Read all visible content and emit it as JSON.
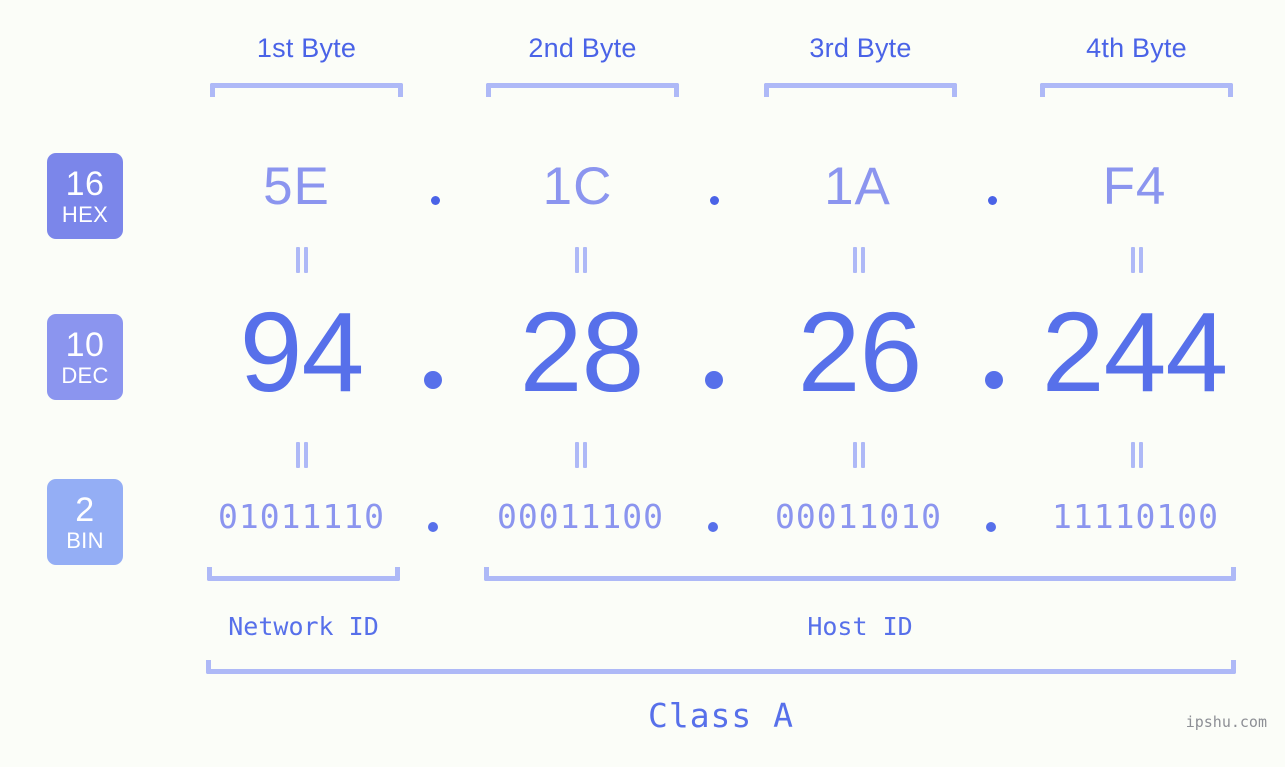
{
  "background_color": "#fbfdf8",
  "accent_colors": {
    "deep_blue": "#4a63e7",
    "mid_blue": "#5770ea",
    "light_blue": "#8b95ef",
    "pale_blue": "#aeb9f7",
    "badge_hex": "#7b86ea",
    "badge_dec": "#8b95ef",
    "badge_bin": "#94aef5",
    "watermark_gray": "#8d8f95"
  },
  "byte_headers": [
    {
      "label": "1st Byte"
    },
    {
      "label": "2nd Byte"
    },
    {
      "label": "3rd Byte"
    },
    {
      "label": "4th Byte"
    }
  ],
  "bases": [
    {
      "number": "16",
      "name": "HEX"
    },
    {
      "number": "10",
      "name": "DEC"
    },
    {
      "number": "2",
      "name": "BIN"
    }
  ],
  "rows": {
    "hex": {
      "values": [
        "5E",
        "1C",
        "1A",
        "F4"
      ],
      "separator": "."
    },
    "dec": {
      "values": [
        "94",
        "28",
        "26",
        "244"
      ],
      "separator": "."
    },
    "bin": {
      "values": [
        "01011110",
        "00011100",
        "00011010",
        "11110100"
      ],
      "separator": "."
    }
  },
  "equals_symbol": "=",
  "id_sections": [
    {
      "label": "Network ID"
    },
    {
      "label": "Host ID"
    }
  ],
  "class_label": "Class A",
  "watermark": "ipshu.com",
  "chart_data": {
    "type": "table",
    "title": "IP address byte breakdown",
    "categories": [
      "1st Byte",
      "2nd Byte",
      "3rd Byte",
      "4th Byte"
    ],
    "series": [
      {
        "name": "HEX",
        "values": [
          "5E",
          "1C",
          "1A",
          "F4"
        ]
      },
      {
        "name": "DEC",
        "values": [
          94,
          28,
          26,
          244
        ]
      },
      {
        "name": "BIN",
        "values": [
          "01011110",
          "00011100",
          "00011010",
          "11110100"
        ]
      }
    ],
    "annotations": [
      "Network ID",
      "Host ID",
      "Class A"
    ]
  }
}
